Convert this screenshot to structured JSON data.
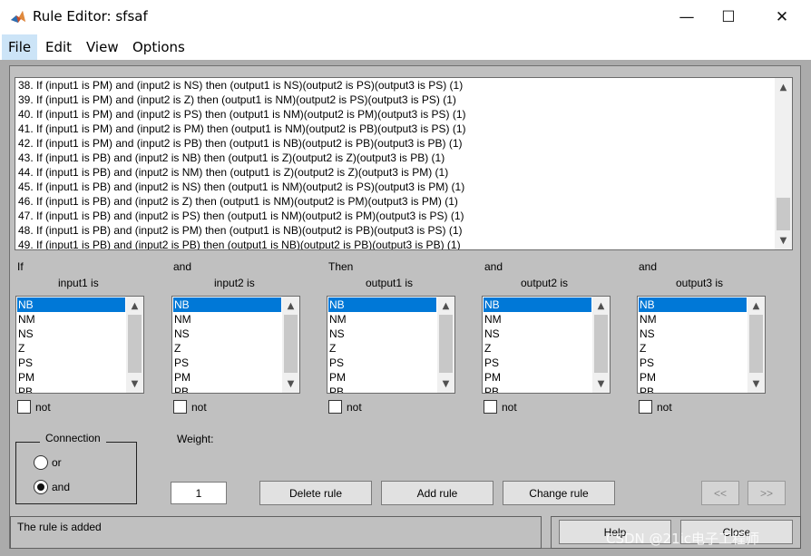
{
  "window": {
    "title": "Rule Editor: sfsaf",
    "minimize": "—",
    "maximize": "☐",
    "close": "✕"
  },
  "menu": {
    "items": [
      {
        "label": "File"
      },
      {
        "label": "Edit"
      },
      {
        "label": "View"
      },
      {
        "label": "Options"
      }
    ]
  },
  "rules": [
    "38. If (input1 is PM) and (input2 is NS) then (output1 is NS)(output2 is PS)(output3 is PS) (1)",
    "39. If (input1 is PM) and (input2 is Z) then (output1 is NM)(output2 is PS)(output3 is PS) (1)",
    "40. If (input1 is PM) and (input2 is PS) then (output1 is NM)(output2 is PM)(output3 is PS) (1)",
    "41. If (input1 is PM) and (input2 is PM) then (output1 is NM)(output2 is PB)(output3 is PS) (1)",
    "42. If (input1 is PM) and (input2 is PB) then (output1 is NB)(output2 is PB)(output3 is PB) (1)",
    "43. If (input1 is PB) and (input2 is NB) then (output1 is Z)(output2 is Z)(output3 is PB) (1)",
    "44. If (input1 is PB) and (input2 is NM) then (output1 is Z)(output2 is Z)(output3 is PM) (1)",
    "45. If (input1 is PB) and (input2 is NS) then (output1 is NM)(output2 is PS)(output3 is PM) (1)",
    "46. If (input1 is PB) and (input2 is Z) then (output1 is NM)(output2 is PM)(output3 is PM) (1)",
    "47. If (input1 is PB) and (input2 is PS) then (output1 is NM)(output2 is PM)(output3 is PS) (1)",
    "48. If (input1 is PB) and (input2 is PM) then (output1 is NB)(output2 is PB)(output3 is PS) (1)",
    "49. If (input1 is PB) and (input2 is PB) then (output1 is NB)(output2 is PB)(output3 is PB) (1)"
  ],
  "columns": [
    {
      "connector": "If",
      "header": "input1 is",
      "options": [
        "NB",
        "NM",
        "NS",
        "Z",
        "PS",
        "PM",
        "PB"
      ],
      "selected": "NB",
      "not_label": "not"
    },
    {
      "connector": "and",
      "header": "input2 is",
      "options": [
        "NB",
        "NM",
        "NS",
        "Z",
        "PS",
        "PM",
        "PB"
      ],
      "selected": "NB",
      "not_label": "not"
    },
    {
      "connector": "Then",
      "header": "output1 is",
      "options": [
        "NB",
        "NM",
        "NS",
        "Z",
        "PS",
        "PM",
        "PB"
      ],
      "selected": "NB",
      "not_label": "not"
    },
    {
      "connector": "and",
      "header": "output2 is",
      "options": [
        "NB",
        "NM",
        "NS",
        "Z",
        "PS",
        "PM",
        "PB"
      ],
      "selected": "NB",
      "not_label": "not"
    },
    {
      "connector": "and",
      "header": "output3 is",
      "options": [
        "NB",
        "NM",
        "NS",
        "Z",
        "PS",
        "PM",
        "PB"
      ],
      "selected": "NB",
      "not_label": "not"
    }
  ],
  "connection": {
    "title": "Connection",
    "options": [
      {
        "label": "or",
        "checked": false
      },
      {
        "label": "and",
        "checked": true
      }
    ]
  },
  "weight": {
    "label": "Weight:",
    "value": "1"
  },
  "buttons": {
    "delete_rule": "Delete rule",
    "add_rule": "Add rule",
    "change_rule": "Change rule",
    "prev": "<<",
    "next": ">>",
    "help": "Help",
    "close": "Close"
  },
  "status": "The rule is added",
  "watermark": "CSDN @21ic电子工程师",
  "colors": {
    "background": "#c0c0c0",
    "selection": "#0078d7"
  }
}
